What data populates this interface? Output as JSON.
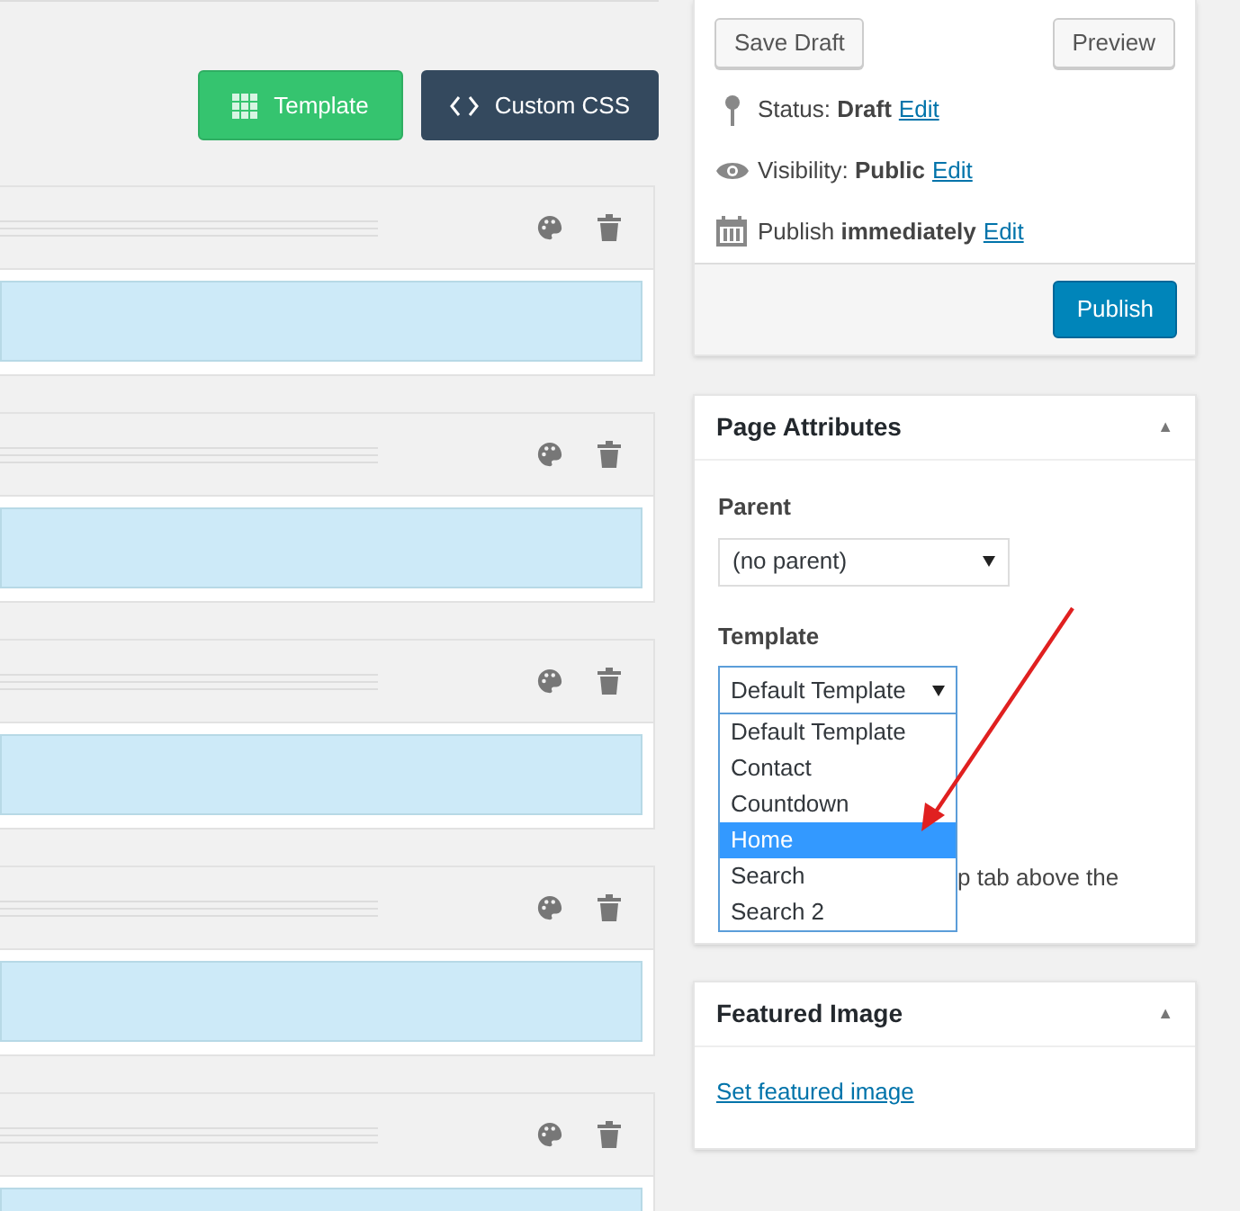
{
  "toolbar": {
    "buttons": [
      {
        "kind": "template",
        "label": "Template"
      },
      {
        "kind": "css",
        "label": "Custom CSS"
      }
    ]
  },
  "rows": [
    {
      "kind": "row"
    },
    {
      "kind": "row"
    },
    {
      "kind": "row"
    },
    {
      "kind": "row"
    },
    {
      "kind": "row"
    }
  ],
  "publish_box": {
    "save_draft": "Save Draft",
    "preview": "Preview",
    "lines": [
      {
        "kind": "status",
        "text": "Status: **Draft**",
        "link": "Edit"
      },
      {
        "kind": "visibility",
        "text": "Visibility: **Public**",
        "link": "Edit"
      },
      {
        "kind": "schedule",
        "text": "Publish **immediately**",
        "link": "Edit"
      }
    ],
    "publish": "Publish"
  },
  "page_attributes": {
    "title": "Page Attributes",
    "toggle": "▲",
    "parent_label": "Parent",
    "parent_value": "(no parent)",
    "template_label": "Template",
    "template_value": "Default Template",
    "hidden_text": "p tab above the",
    "options": [
      {
        "label": "Default Template",
        "selected": false
      },
      {
        "label": "Contact",
        "selected": false
      },
      {
        "label": "Countdown",
        "selected": false
      },
      {
        "label": "Home",
        "selected": true
      },
      {
        "label": "Search",
        "selected": false
      },
      {
        "label": "Search 2",
        "selected": false
      }
    ]
  },
  "featured_image": {
    "title": "Featured Image",
    "toggle": "▲",
    "link": "Set featured image"
  }
}
